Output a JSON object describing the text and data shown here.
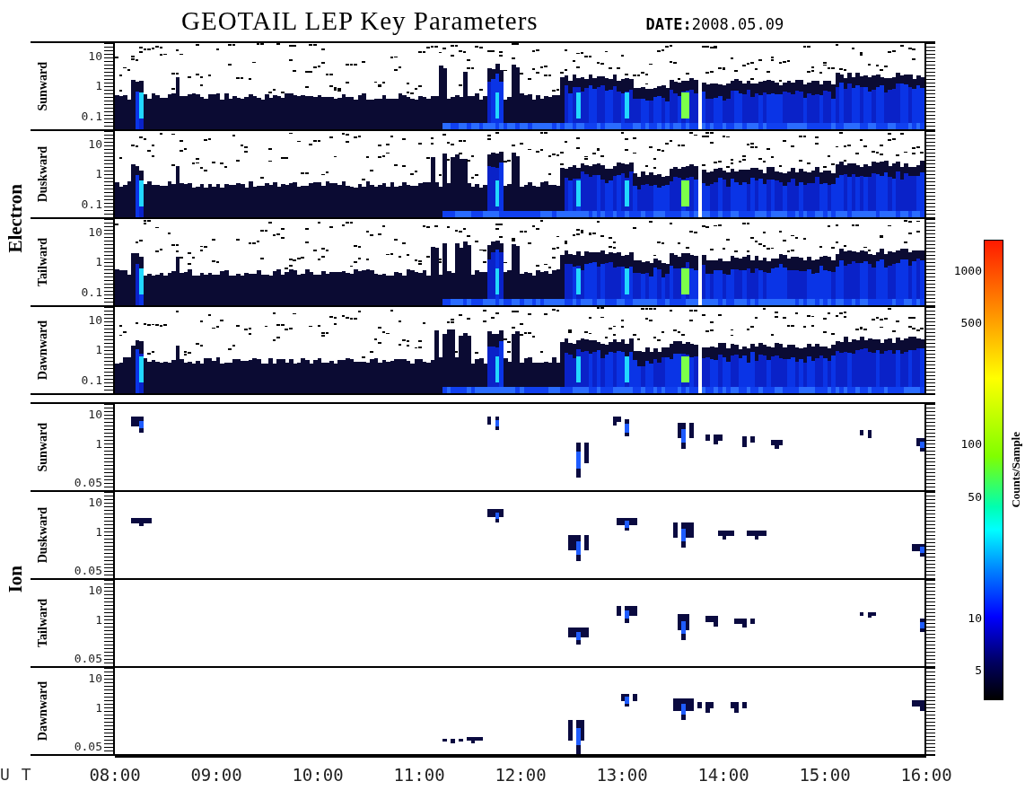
{
  "title": "GEOTAIL LEP Key Parameters",
  "date": "**DATE:**2008.05.09",
  "groups": [
    {
      "name": "Electron",
      "kind": "electron",
      "panels": [
        {
          "label": "Sunward",
          "yticks": [
            "10",
            "1",
            "0.1"
          ]
        },
        {
          "label": "Duskward",
          "yticks": [
            "10",
            "1",
            "0.1"
          ]
        },
        {
          "label": "Tailward",
          "yticks": [
            "10",
            "1",
            "0.1"
          ]
        },
        {
          "label": "Dawnward",
          "yticks": [
            "10",
            "1",
            "0.1"
          ]
        }
      ]
    },
    {
      "name": "Ion",
      "kind": "ion",
      "panels": [
        {
          "label": "Sunward",
          "yticks": [
            "10",
            "1",
            "0.05"
          ]
        },
        {
          "label": "Duskward",
          "yticks": [
            "10",
            "1",
            "0.05"
          ]
        },
        {
          "label": "Tailward",
          "yticks": [
            "10",
            "1",
            "0.05"
          ]
        },
        {
          "label": "Dawnward",
          "yticks": [
            "10",
            "1",
            "0.05"
          ]
        }
      ]
    }
  ],
  "colorbar": {
    "label": "Counts/Sample",
    "ticks": [
      "1000",
      "500",
      "100",
      "50",
      "10",
      "5"
    ]
  },
  "time_axis": {
    "label": "U T",
    "ticks": [
      "08:00",
      "09:00",
      "10:00",
      "11:00",
      "12:00",
      "13:00",
      "14:00",
      "15:00",
      "16:00"
    ]
  }
}
